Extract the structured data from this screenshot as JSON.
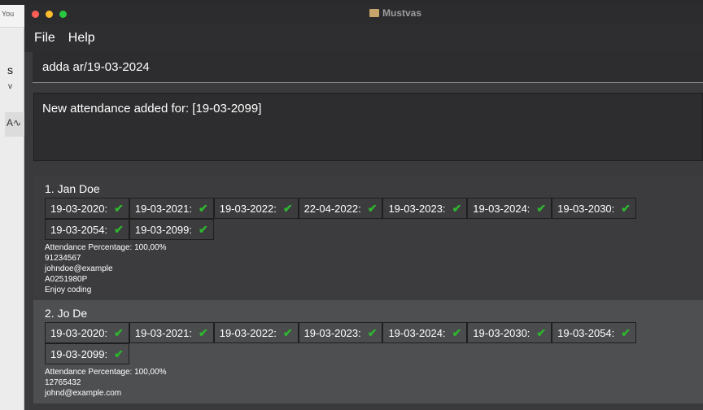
{
  "background_app": {
    "tab_text": "You",
    "letter_s": "s",
    "letter_v": "v",
    "icon_text": "A∿"
  },
  "window": {
    "title": "Mustvas"
  },
  "menu": {
    "file": "File",
    "help": "Help"
  },
  "command": {
    "value": "adda ar/19-03-2024"
  },
  "result": {
    "message": "New attendance added for: [19-03-2099]"
  },
  "persons": [
    {
      "index_name": "1.  Jan Doe",
      "attendance": [
        "19-03-2020:",
        "19-03-2021:",
        "19-03-2022:",
        "22-04-2022:",
        "19-03-2023:",
        "19-03-2024:",
        "19-03-2030:",
        "19-03-2054:",
        "19-03-2099:"
      ],
      "attendance_percentage": "Attendance Percentage: 100,00%",
      "phone": "91234567",
      "email": "johndoe@example",
      "matric": "A0251980P",
      "remark": "Enjoy coding"
    },
    {
      "index_name": "2.  Jo De",
      "attendance": [
        "19-03-2020:",
        "19-03-2021:",
        "19-03-2022:",
        "19-03-2023:",
        "19-03-2024:",
        "19-03-2030:",
        "19-03-2054:",
        "19-03-2099:"
      ],
      "attendance_percentage": "Attendance Percentage: 100,00%",
      "phone": "12765432",
      "email": "johnd@example.com"
    }
  ],
  "colors": {
    "check_green": "#2fb52f",
    "window_bg": "#3a3a3c",
    "selected_card_bg": "#4d4f51"
  },
  "icons": {
    "check": "check-icon"
  }
}
